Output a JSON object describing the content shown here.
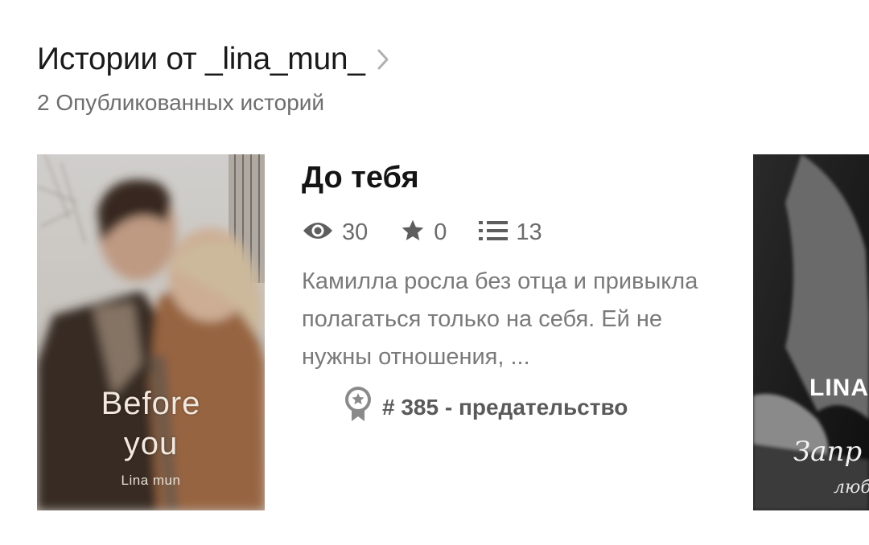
{
  "section": {
    "title": "Истории от _lina_mun_",
    "subtitle": "2 Опубликованных историй"
  },
  "story": {
    "title": "До тебя",
    "views": "30",
    "votes": "0",
    "parts": "13",
    "description": "Камилла росла без отца и привыкла полагаться только на себя. Ей не нужны отношения, ...",
    "ranking": "# 385 - предательство",
    "cover": {
      "title_line1": "Before",
      "title_line2": "you",
      "author": "Lina mun"
    }
  },
  "next_story": {
    "cover": {
      "author": "LINA",
      "title_fragment": "Запр",
      "subtitle_fragment": "люб"
    }
  },
  "icons": {
    "chevron": "chevron-right-icon",
    "views": "eye-icon",
    "votes": "star-icon",
    "parts": "list-icon",
    "ranking": "award-badge-icon"
  },
  "colors": {
    "title": "#1a1a1a",
    "muted": "#6e6e6e",
    "icon": "#5e5e5e"
  }
}
